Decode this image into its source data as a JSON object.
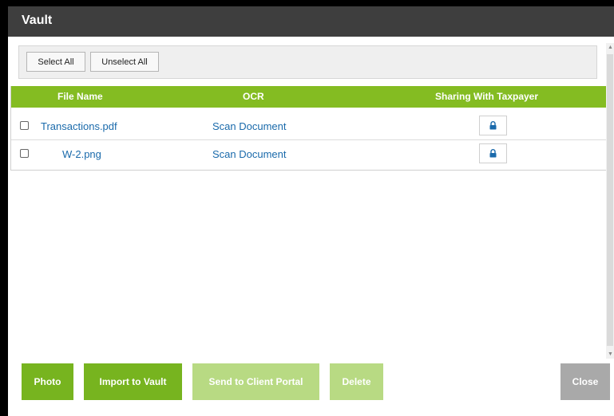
{
  "dialog": {
    "title": "Vault"
  },
  "toolbar": {
    "select_all": "Select All",
    "unselect_all": "Unselect All"
  },
  "table": {
    "headers": {
      "file_name": "File Name",
      "ocr": "OCR",
      "sharing": "Sharing With Taxpayer"
    },
    "rows": [
      {
        "checked": false,
        "file_name": "Transactions.pdf",
        "ocr": "Scan Document",
        "sharing_icon": "lock-icon"
      },
      {
        "checked": false,
        "file_name": "W-2.png",
        "ocr": "Scan Document",
        "sharing_icon": "lock-icon"
      }
    ]
  },
  "footer": {
    "photo": "Photo",
    "import": "Import to Vault",
    "send": "Send to Client Portal",
    "delete": "Delete",
    "close": "Close"
  },
  "colors": {
    "titlebar": "#3e3e3e",
    "accent": "#84bc22",
    "button_primary": "#77b41f",
    "button_disabled": "#b8da83",
    "button_close": "#a9a9a9",
    "link": "#1a6aab"
  }
}
